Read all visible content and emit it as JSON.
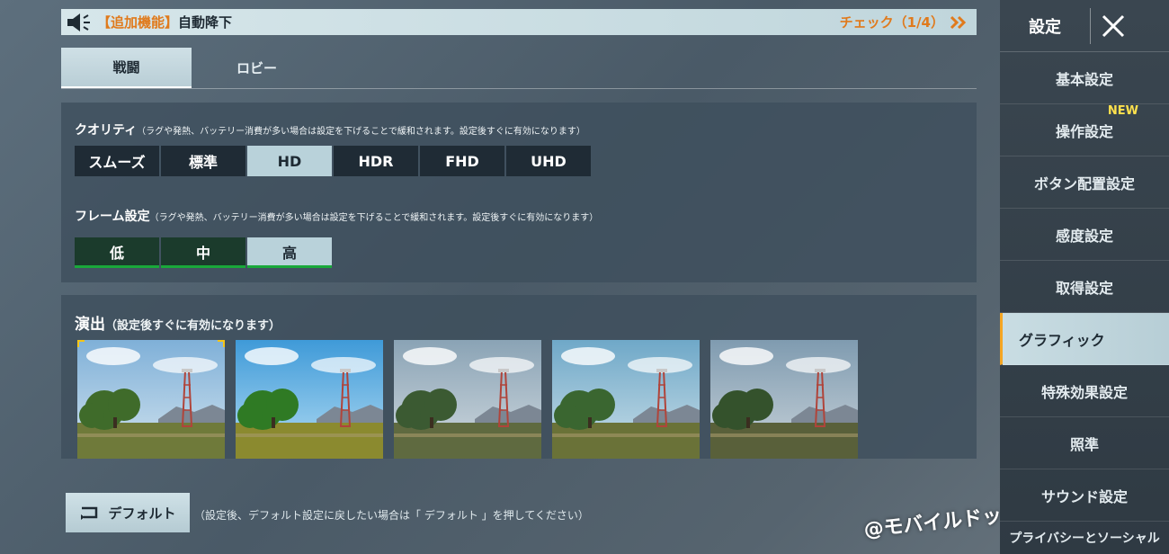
{
  "notice": {
    "tag": "【追加機能】",
    "message": "自動降下",
    "check_label": "チェック（1/4）"
  },
  "tabs": [
    {
      "label": "戦闘",
      "active": true
    },
    {
      "label": "ロビー",
      "active": false
    }
  ],
  "quality": {
    "title": "クオリティ",
    "note": "（ラグや発熱、バッテリー消費が多い場合は設定を下げることで緩和されます。設定後すぐに有効になります）",
    "options": [
      "スムーズ",
      "標準",
      "HD",
      "HDR",
      "FHD",
      "UHD"
    ],
    "selected": "HD"
  },
  "frame": {
    "title": "フレーム設定",
    "note": "（ラグや発熱、バッテリー消費が多い場合は設定を下げることで緩和されます。設定後すぐに有効になります）",
    "options": [
      "低",
      "中",
      "高"
    ],
    "selected": "高"
  },
  "style": {
    "title": "演出",
    "note": "（設定後すぐに有効になります）",
    "selected_index": 0,
    "preset_count": 5
  },
  "footer": {
    "default_label": "デフォルト",
    "default_note": "（設定後、デフォルト設定に戻したい場合は「 デフォルト 」を押してください）",
    "watermark": "@モバイルドットコム"
  },
  "sidebar": {
    "title": "設定",
    "items": [
      {
        "label": "基本設定"
      },
      {
        "label": "操作設定",
        "badge": "NEW"
      },
      {
        "label": "ボタン配置設定"
      },
      {
        "label": "感度設定"
      },
      {
        "label": "取得設定"
      },
      {
        "label": "グラフィック",
        "active": true
      },
      {
        "label": "特殊効果設定"
      },
      {
        "label": "照準"
      },
      {
        "label": "サウンド設定"
      },
      {
        "label": "プライバシーとソーシャル"
      }
    ]
  },
  "colors": {
    "accent_orange": "#e07a1c",
    "selected_bg": "#b9d2da",
    "frame_green": "#19a83a",
    "new_badge": "#ffe14d"
  }
}
